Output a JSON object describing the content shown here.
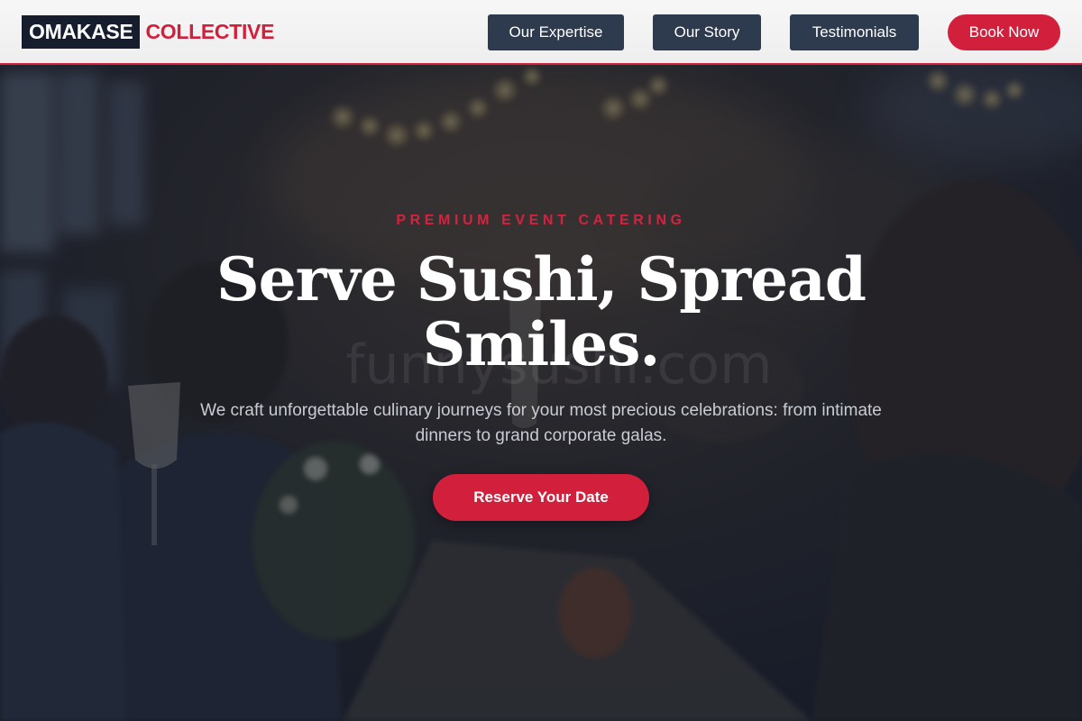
{
  "brand": {
    "name_primary": "OMAKASE",
    "name_secondary": "COLLECTIVE"
  },
  "nav": {
    "items": [
      {
        "label": "Our Expertise"
      },
      {
        "label": "Our Story"
      },
      {
        "label": "Testimonials"
      }
    ],
    "cta_label": "Book Now"
  },
  "hero": {
    "eyebrow": "PREMIUM EVENT CATERING",
    "headline_line1": "Serve Sushi, Spread",
    "headline_line2": "Smiles.",
    "subtitle_line1": "We craft unforgettable culinary journeys for your most precious celebrations: from intimate",
    "subtitle_line2": "dinners to grand corporate galas.",
    "cta_label": "Reserve Your Date",
    "background_image": "banquet-toast-photo"
  },
  "colors": {
    "accent": "#d21f3c",
    "navy": "#161e2e",
    "nav_button": "#2e3a4d",
    "header_bg": "#f2f2f3"
  }
}
